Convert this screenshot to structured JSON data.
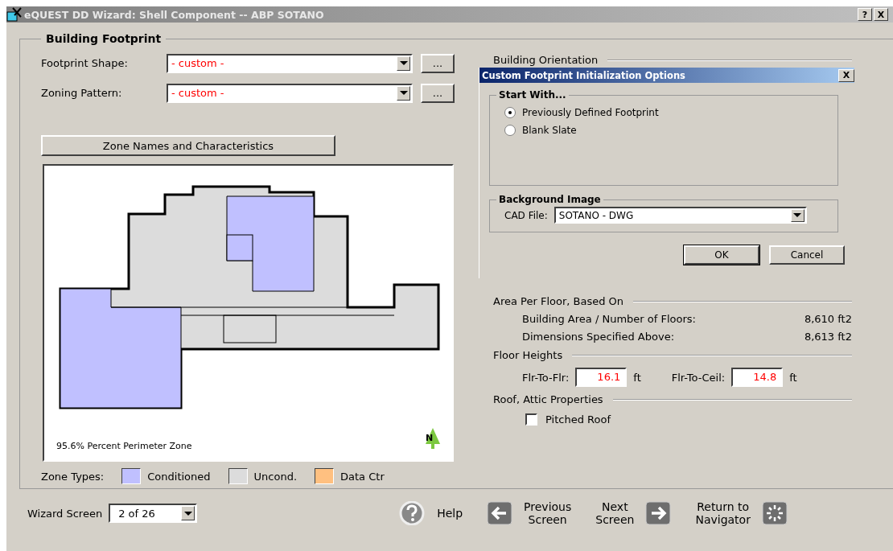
{
  "window": {
    "title": "eQUEST DD Wizard:  Shell Component  --  ABP SOTANO",
    "help_glyph": "?",
    "close_glyph": "X"
  },
  "footprint": {
    "title": "Building Footprint",
    "fields": [
      {
        "label": "Footprint Shape:",
        "value": "- custom -",
        "more": "..."
      },
      {
        "label": "Zoning Pattern:",
        "value": "- custom -",
        "more": "..."
      }
    ],
    "zone_button": "Zone Names and Characteristics",
    "plan": {
      "caption": "95.6% Percent Perimeter Zone",
      "north": "N"
    },
    "zone_types": {
      "label": "Zone Types:",
      "items": [
        {
          "label": "Conditioned",
          "color": "#c0c0ff"
        },
        {
          "label": "Uncond.",
          "color": "#dcdcdc"
        },
        {
          "label": "Data Ctr",
          "color": "#ffc080"
        }
      ]
    }
  },
  "orientation_label": "Building Orientation",
  "dialog": {
    "title": "Custom Footprint Initialization Options",
    "close": "X",
    "start_with": {
      "title": "Start With...",
      "options": [
        {
          "label": "Previously Defined Footprint",
          "selected": true
        },
        {
          "label": "Blank Slate",
          "selected": false
        }
      ]
    },
    "background": {
      "title": "Background Image",
      "cad_label": "CAD File:",
      "cad_value": "SOTANO - DWG"
    },
    "buttons": [
      "OK",
      "Cancel"
    ]
  },
  "area": {
    "title": "Area Per Floor, Based On",
    "rows": [
      {
        "label": "Building Area / Number of Floors:",
        "value": "8,610 ft2"
      },
      {
        "label": "Dimensions Specified Above:",
        "value": "8,613 ft2"
      }
    ]
  },
  "floor_heights": {
    "title": "Floor Heights",
    "fields": [
      {
        "label": "Flr-To-Flr:",
        "value": "16.1",
        "unit": "ft"
      },
      {
        "label": "Flr-To-Ceil:",
        "value": "14.8",
        "unit": "ft"
      }
    ]
  },
  "roof": {
    "title": "Roof, Attic Properties",
    "options": [
      {
        "label": "Pitched Roof",
        "checked": false
      }
    ]
  },
  "footer": {
    "wizard_label": "Wizard Screen",
    "wizard_value": "2 of 26",
    "nav": [
      {
        "kind": "help",
        "lines": [
          "Help"
        ]
      },
      {
        "kind": "previous",
        "lines": [
          "Previous",
          "Screen"
        ]
      },
      {
        "kind": "next",
        "lines": [
          "Next",
          "Screen"
        ]
      },
      {
        "kind": "navigator",
        "lines": [
          "Return to",
          "Navigator"
        ]
      }
    ]
  }
}
